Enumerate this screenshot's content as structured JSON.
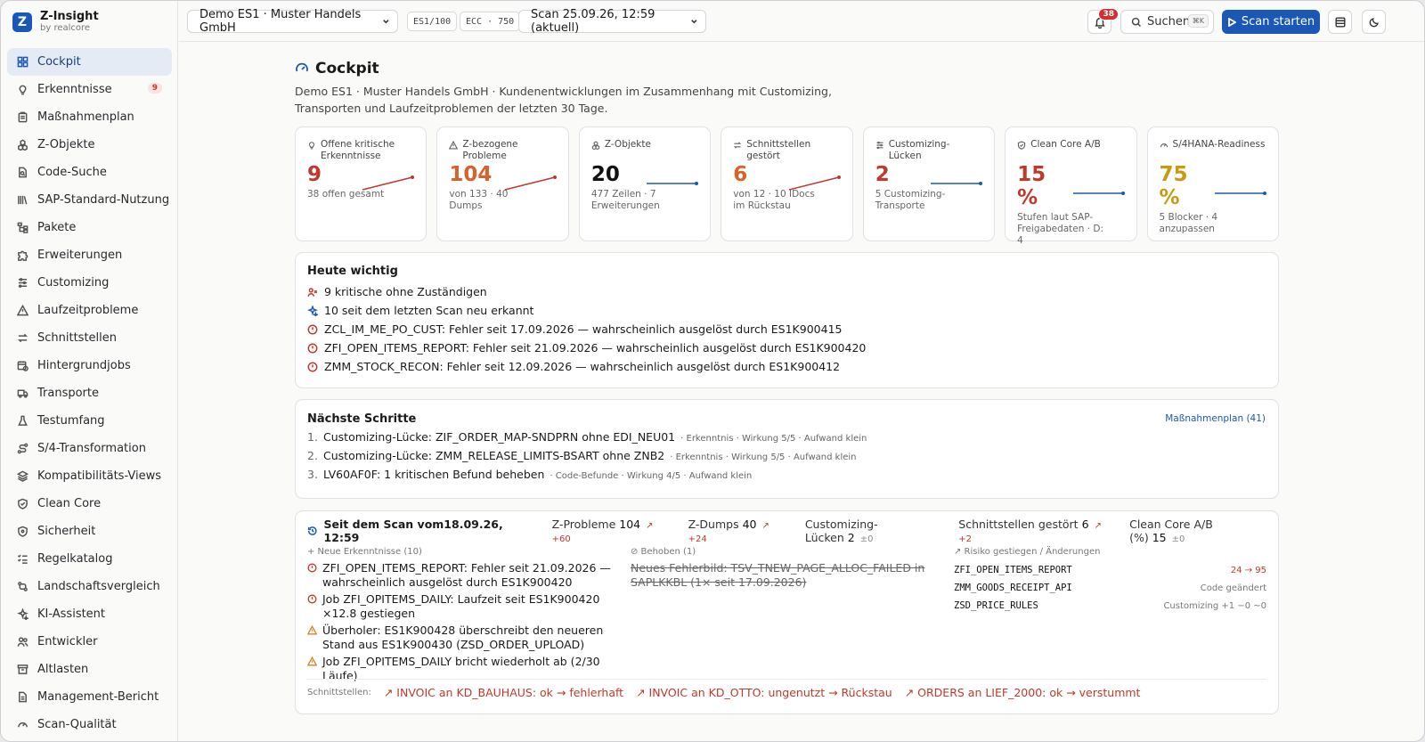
{
  "brand": {
    "name": "Z-Insight",
    "sub": "by realcore",
    "logo_letter": "Z"
  },
  "sidebar": {
    "items": [
      {
        "label": "Cockpit",
        "icon": "grid-icon"
      },
      {
        "label": "Erkenntnisse",
        "icon": "lightbulb-icon",
        "badge": "9"
      },
      {
        "label": "Maßnahmenplan",
        "icon": "clipboard-icon"
      },
      {
        "label": "Z-Objekte",
        "icon": "boxes-icon"
      },
      {
        "label": "Code-Suche",
        "icon": "file-search-icon"
      },
      {
        "label": "SAP-Standard-Nutzung",
        "icon": "library-icon"
      },
      {
        "label": "Pakete",
        "icon": "package-tree-icon"
      },
      {
        "label": "Erweiterungen",
        "icon": "puzzle-icon"
      },
      {
        "label": "Customizing",
        "icon": "sliders-icon"
      },
      {
        "label": "Laufzeitprobleme",
        "icon": "warning-icon"
      },
      {
        "label": "Schnittstellen",
        "icon": "arrows-swap-icon"
      },
      {
        "label": "Hintergrundjobs",
        "icon": "calendar-clock-icon"
      },
      {
        "label": "Transporte",
        "icon": "truck-icon"
      },
      {
        "label": "Testumfang",
        "icon": "flask-icon"
      },
      {
        "label": "S/4-Transformation",
        "icon": "route-icon"
      },
      {
        "label": "Kompatibilitäts-Views",
        "icon": "layers-icon"
      },
      {
        "label": "Clean Core",
        "icon": "shield-check-icon"
      },
      {
        "label": "Sicherheit",
        "icon": "shield-icon"
      },
      {
        "label": "Regelkatalog",
        "icon": "list-checks-icon"
      },
      {
        "label": "Landschaftsvergleich",
        "icon": "git-compare-icon"
      },
      {
        "label": "KI-Assistent",
        "icon": "sparkles-icon"
      },
      {
        "label": "Entwickler",
        "icon": "users-icon"
      },
      {
        "label": "Altlasten",
        "icon": "archive-icon"
      },
      {
        "label": "Management-Bericht",
        "icon": "file-text-icon"
      },
      {
        "label": "Scan-Qualität",
        "icon": "gauge-icon"
      }
    ]
  },
  "topbar": {
    "system_select": "Demo ES1 · Muster Handels GmbH",
    "tag_client": "ES1/100",
    "tag_release": "ECC · 750",
    "scan_select": "Scan 25.09.26, 12:59 (aktuell)",
    "notif_count": "38",
    "search_label": "Suchen",
    "search_kbd": "⌘K",
    "scan_button": "Scan starten"
  },
  "page": {
    "title": "Cockpit",
    "subtitle": "Demo ES1 · Muster Handels GmbH · Kundenentwicklungen im Zusammenhang mit Customizing, Transporten und Laufzeitproblemen der letzten 30 Tage."
  },
  "kpis": [
    {
      "label": "Offene kritische Erkenntnisse",
      "value": "9",
      "foot": "38 offen gesamt",
      "color": "#c0392b",
      "trend": "up",
      "icon": "lightbulb-icon"
    },
    {
      "label": "Z-bezogene Probleme",
      "value": "104",
      "foot": "von 133 · 40 Dumps",
      "color": "#d9622b",
      "trend": "up",
      "icon": "warning-icon"
    },
    {
      "label": "Z-Objekte",
      "value": "20",
      "foot": "477 Zeilen · 7 Erweiterungen",
      "color": "#111111",
      "trend": "flat",
      "icon": "boxes-icon"
    },
    {
      "label": "Schnittstellen gestört",
      "value": "6",
      "foot": "von 12 · 10 IDocs im Rückstau",
      "color": "#d9622b",
      "trend": "up",
      "icon": "arrows-swap-icon"
    },
    {
      "label": "Customizing-Lücken",
      "value": "2",
      "foot": "5 Customizing-Transporte",
      "color": "#c0392b",
      "trend": "flat",
      "icon": "sliders-icon"
    },
    {
      "label": "Clean Core A/B",
      "value": "15",
      "unit": "%",
      "foot": "Stufen laut SAP-Freigabedaten · D: 4",
      "color": "#c0392b",
      "trend": "flat",
      "icon": "shield-check-icon"
    },
    {
      "label": "S/4HANA-Readiness",
      "value": "75",
      "unit": "%",
      "foot": "5 Blocker · 4 anzupassen",
      "color": "#c99a10",
      "trend": "flat",
      "icon": "gauge-icon"
    }
  ],
  "today": {
    "title": "Heute wichtig",
    "items": [
      {
        "text": "9 kritische ohne Zuständigen",
        "icon": "user-x-icon"
      },
      {
        "text": "10 seit dem letzten Scan neu erkannt",
        "icon": "sparkles-icon"
      },
      {
        "text": "ZCL_IM_ME_PO_CUST: Fehler seit 17.09.2026 — wahrscheinlich ausgelöst durch ES1K900415",
        "icon": "alert-circle-icon"
      },
      {
        "text": "ZFI_OPEN_ITEMS_REPORT: Fehler seit 21.09.2026 — wahrscheinlich ausgelöst durch ES1K900420",
        "icon": "alert-circle-icon"
      },
      {
        "text": "ZMM_STOCK_RECON: Fehler seit 12.09.2026 — wahrscheinlich ausgelöst durch ES1K900412",
        "icon": "alert-circle-icon"
      }
    ]
  },
  "next_steps": {
    "title": "Nächste Schritte",
    "link": "Maßnahmenplan (41)",
    "items": [
      {
        "num": "1.",
        "text": "Customizing-Lücke: ZIF_ORDER_MAP-SNDPRN ohne EDI_NEU01",
        "meta": "· Erkenntnis · Wirkung 5/5 · Aufwand klein"
      },
      {
        "num": "2.",
        "text": "Customizing-Lücke: ZMM_RELEASE_LIMITS-BSART ohne ZNB2",
        "meta": "· Erkenntnis · Wirkung 5/5 · Aufwand klein"
      },
      {
        "num": "3.",
        "text": "LV60AF0F: 1 kritischen Befund beheben",
        "meta": "· Code-Befunde · Wirkung 4/5 · Aufwand klein"
      }
    ]
  },
  "since_scan": {
    "title": "Seit dem Scan vom18.09.26, 12:59",
    "metrics": [
      {
        "label": "Z-Probleme",
        "value": "104",
        "delta": "↗ +60",
        "kind": "up"
      },
      {
        "label": "Z-Dumps",
        "value": "40",
        "delta": "↗ +24",
        "kind": "up"
      },
      {
        "label": "Customizing-Lücken",
        "value": "2",
        "delta": "±0",
        "kind": "zero"
      },
      {
        "label": "Schnittstellen gestört",
        "value": "6",
        "delta": "↗ +2",
        "kind": "up"
      },
      {
        "label": "Clean Core A/B (%)",
        "value": "15",
        "delta": "±0",
        "kind": "zero"
      }
    ],
    "new_head": "+ Neue Erkenntnisse (10)",
    "new_items": [
      {
        "text": "ZFI_OPEN_ITEMS_REPORT: Fehler seit 21.09.2026 — wahrscheinlich ausgelöst durch ES1K900420",
        "kind": "error"
      },
      {
        "text": "Job ZFI_OPITEMS_DAILY: Laufzeit seit ES1K900420 ×12.8 gestiegen",
        "kind": "error"
      },
      {
        "text": "Überholer: ES1K900428 überschreibt den neueren Stand aus ES1K900430 (ZSD_ORDER_UPLOAD)",
        "kind": "warn"
      },
      {
        "text": "Job ZFI_OPITEMS_DAILY bricht wiederholt ab (2/30 Läufe)",
        "kind": "warn"
      }
    ],
    "fixed_head": "⊘ Behoben (1)",
    "fixed_items": [
      "Neues Fehlerbild: TSV_TNEW_PAGE_ALLOC_FAILED in SAPLKKBL (1× seit 17.09.2026)"
    ],
    "risk_head": "↗ Risiko gestiegen / Änderungen",
    "risk_items": [
      {
        "name": "ZFI_OPEN_ITEMS_REPORT",
        "value": "24 → 95",
        "kind": "up"
      },
      {
        "name": "ZMM_GOODS_RECEIPT_API",
        "value": "Code geändert",
        "kind": "info"
      },
      {
        "name": "ZSD_PRICE_RULES",
        "value": "Customizing +1 −0 ~0",
        "kind": "info"
      }
    ],
    "ifaces_label": "Schnittstellen:",
    "ifaces": [
      "↗ INVOIC an KD_BAUHAUS: ok → fehlerhaft",
      "↗ INVOIC an KD_OTTO: ungenutzt → Rückstau",
      "↗ ORDERS an LIEF_2000: ok → verstummt"
    ]
  },
  "colors": {
    "accent": "#1b57b5",
    "error": "#c0392b",
    "warn": "#d9822b",
    "yellow": "#c99a10"
  }
}
